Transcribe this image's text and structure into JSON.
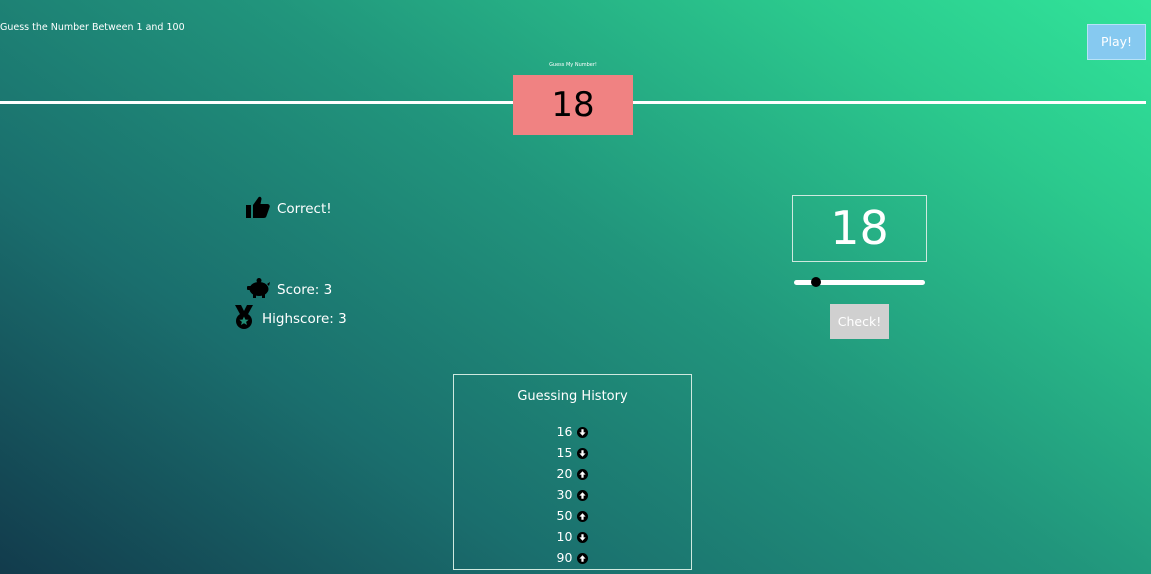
{
  "header": {
    "subtitle": "Guess the Number Between 1 and 100",
    "play_label": "Play!",
    "secret_label": "Guess My Number!",
    "secret_number": "18"
  },
  "status": {
    "message": "Correct!",
    "message_icon": "thumbs-up-icon",
    "score": "Score: 3",
    "score_icon": "piggy-bank-icon",
    "highscore": "Highscore: 3",
    "highscore_icon": "medal-icon"
  },
  "guess": {
    "value": "18",
    "slider_value": 18,
    "slider_min": 1,
    "slider_max": 100,
    "check_label": "Check!"
  },
  "history": {
    "title": "Guessing History",
    "items": [
      {
        "value": "16",
        "direction": "down"
      },
      {
        "value": "15",
        "direction": "down"
      },
      {
        "value": "20",
        "direction": "up"
      },
      {
        "value": "30",
        "direction": "up"
      },
      {
        "value": "50",
        "direction": "up"
      },
      {
        "value": "10",
        "direction": "down"
      },
      {
        "value": "90",
        "direction": "up"
      }
    ]
  },
  "colors": {
    "secret_box": "#f08282",
    "play_button": "#86c9f0",
    "check_button": "#d0d0d0"
  }
}
